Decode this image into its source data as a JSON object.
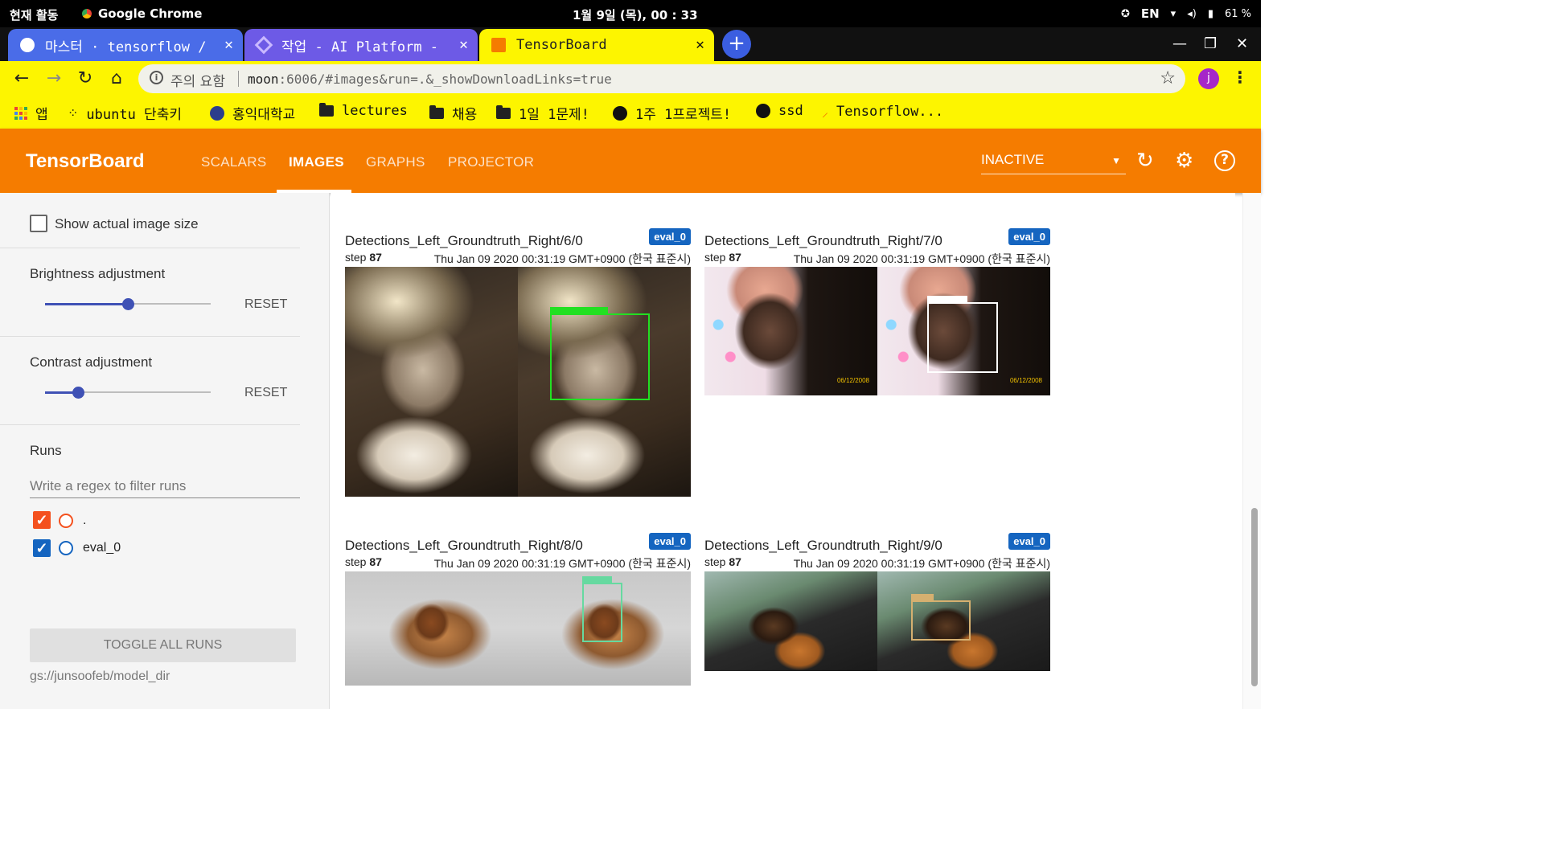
{
  "os": {
    "activities": "현재 활동",
    "app_name": "Google Chrome",
    "clock": "1월 9일 (목), 00 : 33",
    "lang": "EN",
    "battery": "61 %"
  },
  "tabs": [
    {
      "icon": "github-icon",
      "label": "마스터 · tensorflow /"
    },
    {
      "icon": "ai-platform-icon",
      "label": "작업 - AI Platform -"
    },
    {
      "icon": "tensorboard-icon",
      "label": "TensorBoard"
    }
  ],
  "address": {
    "security_label": "주의 요함",
    "url_host": "moon",
    "url_rest": ":6006/#images&run=.&_showDownloadLinks=true",
    "profile_initial": "j"
  },
  "bookmarks": [
    {
      "icon": "apps-icon",
      "label": "앱"
    },
    {
      "icon": "ubuntu-icon",
      "label": "ubuntu 단축키"
    },
    {
      "icon": "university-icon",
      "label": "홍익대학교"
    },
    {
      "icon": "folder-icon",
      "label": "lectures"
    },
    {
      "icon": "folder-icon",
      "label": "채용"
    },
    {
      "icon": "folder-icon",
      "label": "1일 1문제!"
    },
    {
      "icon": "github-icon",
      "label": "1주 1프로젝트!"
    },
    {
      "icon": "github-icon",
      "label": "ssd"
    },
    {
      "icon": "tensorflow-icon",
      "label": "Tensorflow..."
    }
  ],
  "tensorboard": {
    "title": "TensorBoard",
    "nav": [
      "SCALARS",
      "IMAGES",
      "GRAPHS",
      "PROJECTOR"
    ],
    "active_nav": "IMAGES",
    "inactive_select": "INACTIVE",
    "accent_color": "#f57c00"
  },
  "sidebar": {
    "show_actual_size_label": "Show actual image size",
    "show_actual_size_checked": false,
    "brightness": {
      "label": "Brightness adjustment",
      "reset": "RESET",
      "level": 0.5
    },
    "contrast": {
      "label": "Contrast adjustment",
      "reset": "RESET",
      "level": 0.2
    },
    "runs_title": "Runs",
    "filter_placeholder": "Write a regex to filter runs",
    "runs": [
      {
        "name": ".",
        "checked": true,
        "color": "#f4511e"
      },
      {
        "name": "eval_0",
        "checked": true,
        "color": "#1565c0"
      }
    ],
    "toggle_all": "TOGGLE ALL RUNS",
    "logdir": "gs://junsoofeb/model_dir"
  },
  "cards": [
    {
      "title": "Detections_Left_Groundtruth_Right/6/0",
      "badge": "eval_0",
      "step_label": "step",
      "step": "87",
      "timestamp": "Thu Jan 09 2020 00:31:19 GMT+0900 (한국 표준시)",
      "subject": "cat"
    },
    {
      "title": "Detections_Left_Groundtruth_Right/7/0",
      "badge": "eval_0",
      "step_label": "step",
      "step": "87",
      "timestamp": "Thu Jan 09 2020 00:31:19 GMT+0900 (한국 표준시)",
      "subject": "dog-and-person",
      "photo_date": "06/12/2008"
    },
    {
      "title": "Detections_Left_Groundtruth_Right/8/0",
      "badge": "eval_0",
      "step_label": "step",
      "step": "87",
      "timestamp": "Thu Jan 09 2020 00:31:19 GMT+0900 (한국 표준시)",
      "subject": "pomeranian"
    },
    {
      "title": "Detections_Left_Groundtruth_Right/9/0",
      "badge": "eval_0",
      "step_label": "step",
      "step": "87",
      "timestamp": "Thu Jan 09 2020 00:31:19 GMT+0900 (한국 표준시)",
      "subject": "dog-in-car"
    }
  ]
}
